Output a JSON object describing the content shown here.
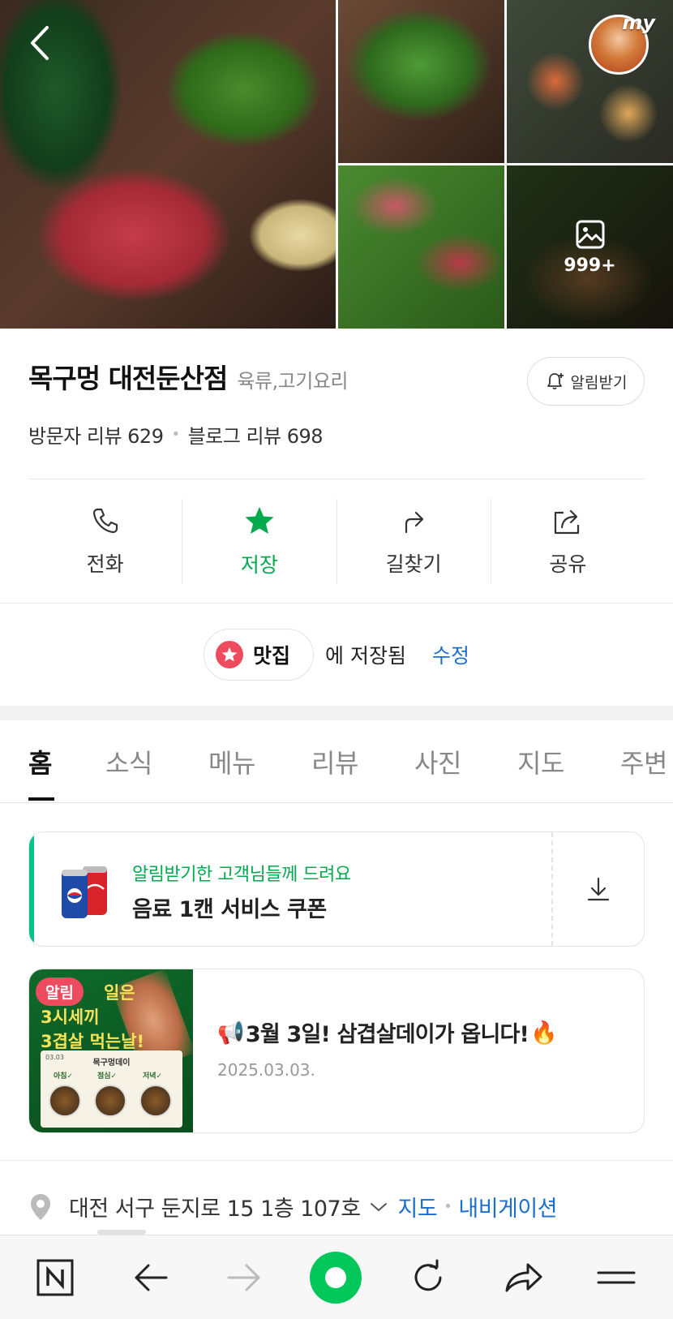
{
  "gallery": {
    "more_count": "999+",
    "my_tag": "my"
  },
  "place": {
    "name": "목구멍 대전둔산점",
    "category": "육류,고기요리",
    "notify_label": "알림받기",
    "visitor_reviews": "방문자 리뷰 629",
    "blog_reviews": "블로그 리뷰 698"
  },
  "actions": [
    {
      "label": "전화",
      "icon": "phone-icon"
    },
    {
      "label": "저장",
      "icon": "star-icon",
      "active": true
    },
    {
      "label": "길찾기",
      "icon": "directions-icon"
    },
    {
      "label": "공유",
      "icon": "share-icon"
    }
  ],
  "saved": {
    "list_name": "맛집",
    "saved_text": "에 저장됨",
    "edit_label": "수정"
  },
  "tabs": [
    {
      "label": "홈",
      "active": true
    },
    {
      "label": "소식"
    },
    {
      "label": "메뉴"
    },
    {
      "label": "리뷰"
    },
    {
      "label": "사진"
    },
    {
      "label": "지도"
    },
    {
      "label": "주변"
    }
  ],
  "coupon": {
    "subtitle": "알림받기한 고객님들께 드려요",
    "title": "음료 1캔 서비스 쿠폰"
  },
  "news": {
    "badge": "알림",
    "thumb_line1": "일은",
    "thumb_line2": "3시세끼",
    "thumb_line3": "3겹살 먹는날!",
    "thumb_board_title": "목구멍데이",
    "thumb_board_date": "03.03",
    "thumb_labels": [
      "아침✓",
      "점심✓",
      "저녁✓"
    ],
    "title_emoji": "📢",
    "title": "3월 3일! 삼겹살데이가 옵니다!",
    "title_emoji_end": "🔥",
    "date": "2025.03.03."
  },
  "address": {
    "text": "대전 서구 둔지로 15 1층 107호",
    "map_link": "지도",
    "nav_link": "내비게이션"
  },
  "colors": {
    "brand_green": "#03c75a",
    "saved_green": "#03a94d",
    "link_blue": "#1a6fd0",
    "badge_red": "#ef4b5e"
  }
}
